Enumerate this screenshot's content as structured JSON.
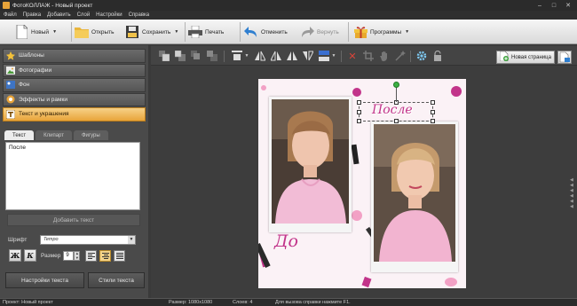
{
  "window": {
    "title": "ФотоКОЛЛАЖ - Новый проект"
  },
  "menu": [
    "Файл",
    "Правка",
    "Добавить",
    "Слой",
    "Настройки",
    "Справка"
  ],
  "toolbar": {
    "new_label": "Новый",
    "open_label": "Открыть",
    "save_label": "Сохранить",
    "print_label": "Печать",
    "undo_label": "Отменить",
    "redo_label": "Вернуть",
    "programs_label": "Программы"
  },
  "left_panel": {
    "categories": [
      "Шаблоны",
      "Фотографии",
      "Фон",
      "Эффекты и рамки",
      "Текст и украшения"
    ],
    "active_category": "Текст и украшения",
    "tabs": [
      "Текст",
      "Клипарт",
      "Фигуры"
    ],
    "active_tab": "Текст",
    "text_value": "После",
    "add_text_label": "Добавить текст",
    "font_label": "Шрифт",
    "font_value": "Tempo",
    "bold_label": "Ж",
    "italic_label": "К",
    "size_label": "Размер",
    "size_value": "9",
    "text_settings_label": "Настройки текста",
    "text_styles_label": "Стили текста"
  },
  "editor": {
    "new_page_label": "Новая страница",
    "canvas_text_before": "До",
    "canvas_text_after": "После"
  },
  "status": {
    "project": "Проект: Новый проект",
    "size": "Размер: 1080x1080",
    "layers": "Слоев: 4",
    "hint": "Для вызова справки нажмите F1."
  },
  "colors": {
    "accent": "#e8a43a",
    "canvas_text": "#c2348a",
    "canvas_bg": "#fbf2f6"
  }
}
